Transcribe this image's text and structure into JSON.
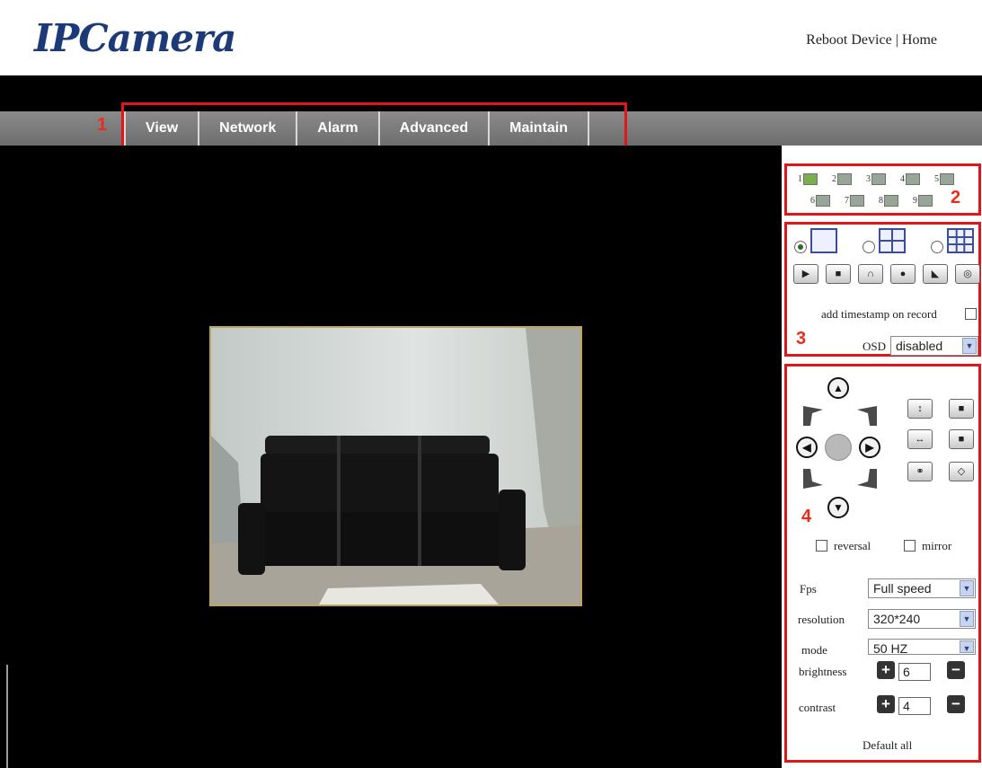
{
  "header": {
    "logo_text": "IPCamera",
    "reboot_link": "Reboot Device",
    "separator": " | ",
    "home_link": "Home"
  },
  "nav": {
    "items": [
      {
        "label": "View"
      },
      {
        "label": "Network"
      },
      {
        "label": "Alarm"
      },
      {
        "label": "Advanced"
      },
      {
        "label": "Maintain"
      }
    ]
  },
  "annotations": {
    "n1": "1",
    "n2": "2",
    "n3": "3",
    "n4": "4"
  },
  "cameras": [
    "1",
    "2",
    "3",
    "4",
    "5",
    "6",
    "7",
    "8",
    "9"
  ],
  "record": {
    "timestamp_label": "add timestamp on record",
    "osd_label": "OSD",
    "osd_value": "disabled"
  },
  "ptz": {
    "reversal_label": "reversal",
    "mirror_label": "mirror"
  },
  "settings": {
    "fps_label": "Fps",
    "fps_value": "Full speed",
    "resolution_label": "resolution",
    "resolution_value": "320*240",
    "mode_label": "mode",
    "mode_value": "50 HZ",
    "brightness_label": "brightness",
    "brightness_value": "6",
    "contrast_label": "contrast",
    "contrast_value": "4",
    "default_label": "Default all"
  }
}
